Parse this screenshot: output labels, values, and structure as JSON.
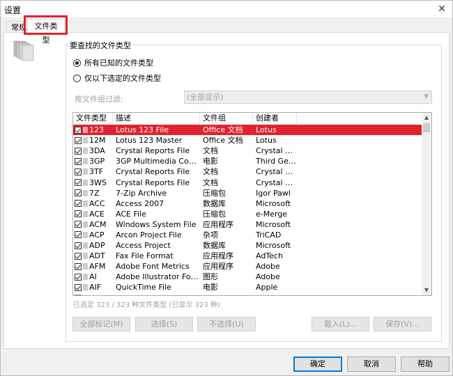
{
  "window": {
    "title": "设置",
    "close_glyph": "✕"
  },
  "tabs": [
    {
      "label": "常规"
    },
    {
      "label": "文件类型",
      "active": true
    }
  ],
  "group": {
    "label": "要查找的文件类型",
    "radio_all": "所有已知的文件类型",
    "radio_selected": "仅以下选定的文件类型",
    "filter_label": "按文件组过滤:",
    "filter_value": "(全部显示)"
  },
  "list": {
    "headers": [
      "文件类型",
      "描述",
      "文件组",
      "创建者"
    ],
    "rows": [
      [
        "123",
        "Lotus 123 File",
        "Office 文档",
        "Lotus"
      ],
      [
        "12M",
        "Lotus 123 Master",
        "Office 文档",
        "Lotus"
      ],
      [
        "3DA",
        "Crystal Reports File",
        "文档",
        "Crystal De..."
      ],
      [
        "3GP",
        "3GP Multimedia Contain...",
        "电影",
        "Third Gen..."
      ],
      [
        "3TF",
        "Crystal Reports File",
        "文档",
        "Crystal De..."
      ],
      [
        "3WS",
        "Crystal Reports File",
        "文档",
        "Crystal De..."
      ],
      [
        "7Z",
        "7-Zip Archive",
        "压缩包",
        "Igor Pawl"
      ],
      [
        "ACC",
        "Access 2007",
        "数据库",
        "Microsoft"
      ],
      [
        "ACE",
        "ACE File",
        "压缩包",
        "e-Merge"
      ],
      [
        "ACM",
        "Windows System File",
        "应用程序",
        "Microsoft"
      ],
      [
        "ACP",
        "Arcon Project File",
        "杂项",
        "TriCAD"
      ],
      [
        "ADP",
        "Access Project",
        "数据库",
        "Microsoft"
      ],
      [
        "ADT",
        "Fax File Format",
        "应用程序",
        "AdTech"
      ],
      [
        "AFM",
        "Adobe Font Metrics",
        "应用程序",
        "Adobe"
      ],
      [
        "AI",
        "Adobe Illustrator Format",
        "图形",
        "Adobe"
      ],
      [
        "AIF",
        "QuickTime File",
        "电影",
        "Apple"
      ],
      [
        "AIM",
        "Sound File Format",
        "",
        ""
      ]
    ]
  },
  "status": "已选定 323 / 323 种文件类型 (已显示 323 种)",
  "buttons": {
    "mark_all": "全部标记(M)",
    "select": "选择(S)",
    "deselect": "不选择(U)",
    "load": "载入(L)...",
    "save": "保存(V)..."
  },
  "dialog": {
    "ok": "确定",
    "cancel": "取消",
    "help": "帮助"
  },
  "colors": {
    "selection": "#e0222e",
    "highlight_box": "#e0222e",
    "default_button_border": "#0078d7"
  }
}
